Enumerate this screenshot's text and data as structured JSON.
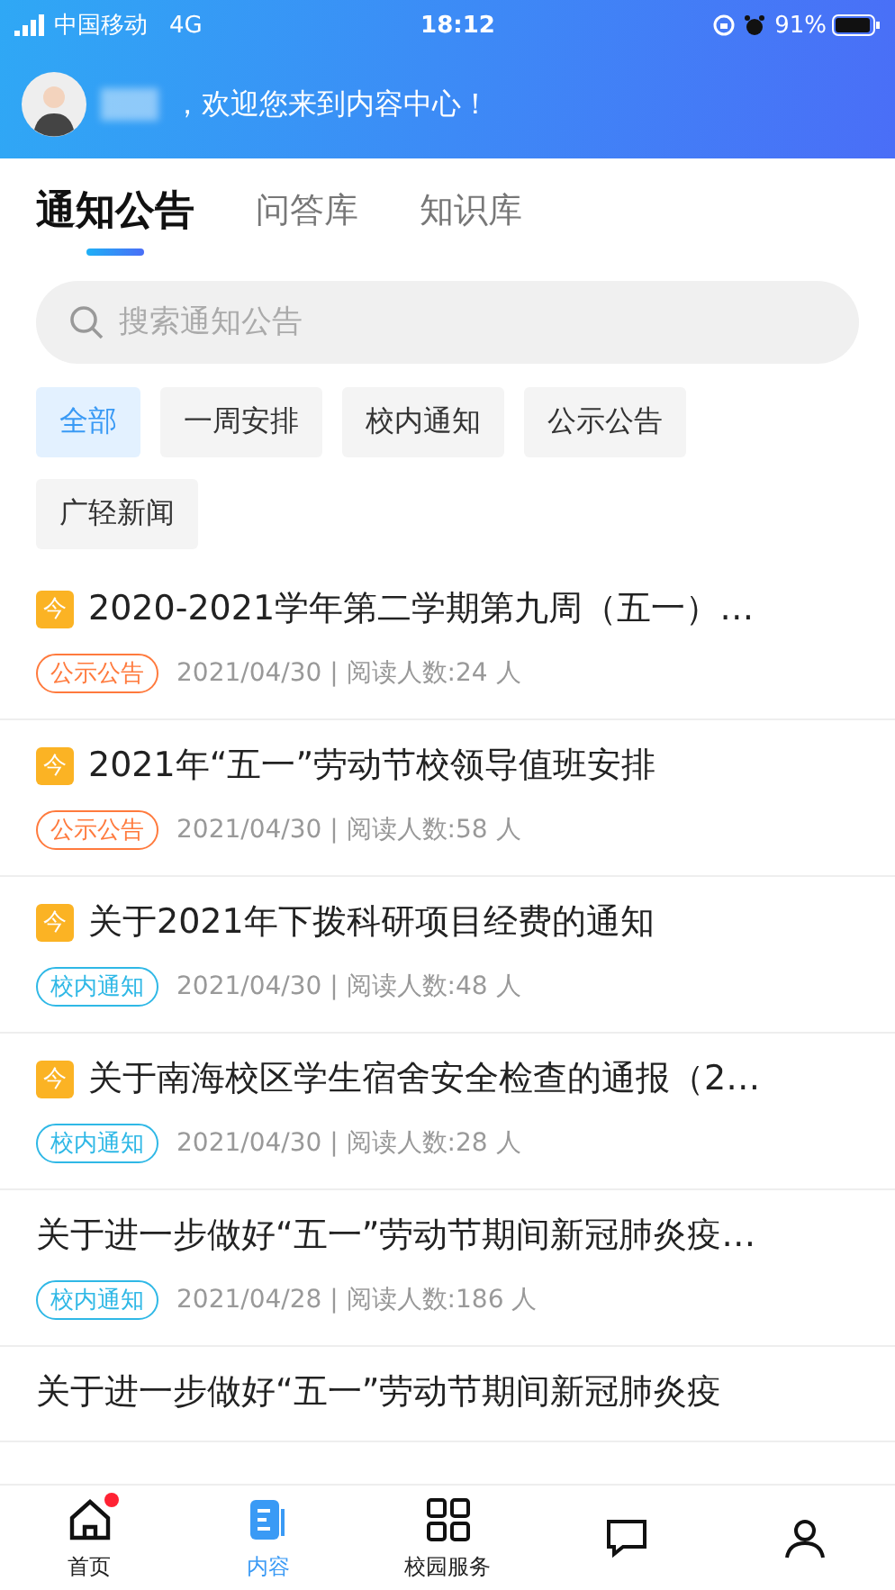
{
  "status_bar": {
    "carrier": "中国移动",
    "network": "4G",
    "time": "18:12",
    "battery": "91%"
  },
  "header": {
    "greeting": "，欢迎您来到内容中心！"
  },
  "tabs": [
    {
      "label": "通知公告",
      "selected": true
    },
    {
      "label": "问答库",
      "selected": false
    },
    {
      "label": "知识库",
      "selected": false
    }
  ],
  "search": {
    "placeholder": "搜索通知公告"
  },
  "filters": [
    {
      "label": "全部",
      "selected": true
    },
    {
      "label": "一周安排",
      "selected": false
    },
    {
      "label": "校内通知",
      "selected": false
    },
    {
      "label": "公示公告",
      "selected": false
    },
    {
      "label": "广轻新闻",
      "selected": false
    }
  ],
  "notices": [
    {
      "badge": "今",
      "title": "2020-2021学年第二学期第九周（五一）…",
      "tag": "公示公告",
      "color": "#ff7a3d",
      "meta": "2021/04/30 | 阅读人数:24 人"
    },
    {
      "badge": "今",
      "title": "2021年“五一”劳动节校领导值班安排",
      "tag": "公示公告",
      "color": "#ff7a3d",
      "meta": "2021/04/30 | 阅读人数:58 人"
    },
    {
      "badge": "今",
      "title": "关于2021年下拨科研项目经费的通知",
      "tag": "校内通知",
      "color": "#2fb8e6",
      "meta": "2021/04/30 | 阅读人数:48 人"
    },
    {
      "badge": "今",
      "title": "关于南海校区学生宿舍安全检查的通报（2…",
      "tag": "校内通知",
      "color": "#2fb8e6",
      "meta": "2021/04/30 | 阅读人数:28 人"
    },
    {
      "title": "关于进一步做好“五一”劳动节期间新冠肺炎疫…",
      "tag": "校内通知",
      "color": "#2fb8e6",
      "meta": "2021/04/28 | 阅读人数:186 人"
    },
    {
      "title": "关于进一步做好“五一”劳动节期间新冠肺炎疫"
    }
  ],
  "bottom_nav": [
    {
      "kind": "home",
      "label": "首页",
      "selected": false,
      "dot": true
    },
    {
      "kind": "content",
      "label": "内容",
      "selected": true,
      "dot": false
    },
    {
      "kind": "grid",
      "label": "校园服务",
      "selected": false,
      "dot": false
    },
    {
      "kind": "chat",
      "selected": false,
      "dot": false
    },
    {
      "kind": "person",
      "selected": false,
      "dot": false
    }
  ]
}
